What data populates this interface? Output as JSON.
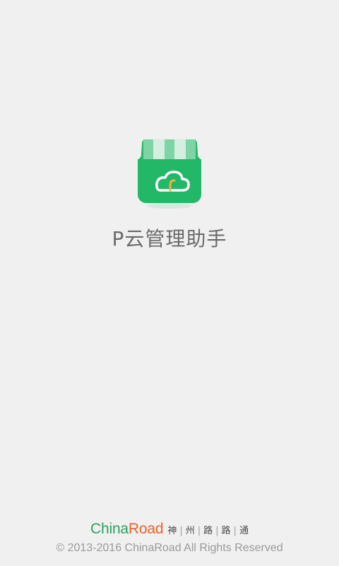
{
  "app": {
    "title": "P云管理助手",
    "icon": "storefront-cloud-icon"
  },
  "brand": {
    "logo_part1": "China",
    "logo_part2": "Road",
    "slogan_chars": [
      "神",
      "州",
      "路",
      "路",
      "通"
    ],
    "slogan_separator": "|"
  },
  "footer": {
    "copyright": "© 2013-2016 ChinaRoad All Rights Reserved"
  },
  "colors": {
    "background": "#f0f0f0",
    "icon_green": "#23b768",
    "icon_awning_light": "#d4efe0",
    "brand_green": "#2aa060",
    "brand_orange": "#e8622a",
    "cloud_accent": "#f3b33d"
  }
}
